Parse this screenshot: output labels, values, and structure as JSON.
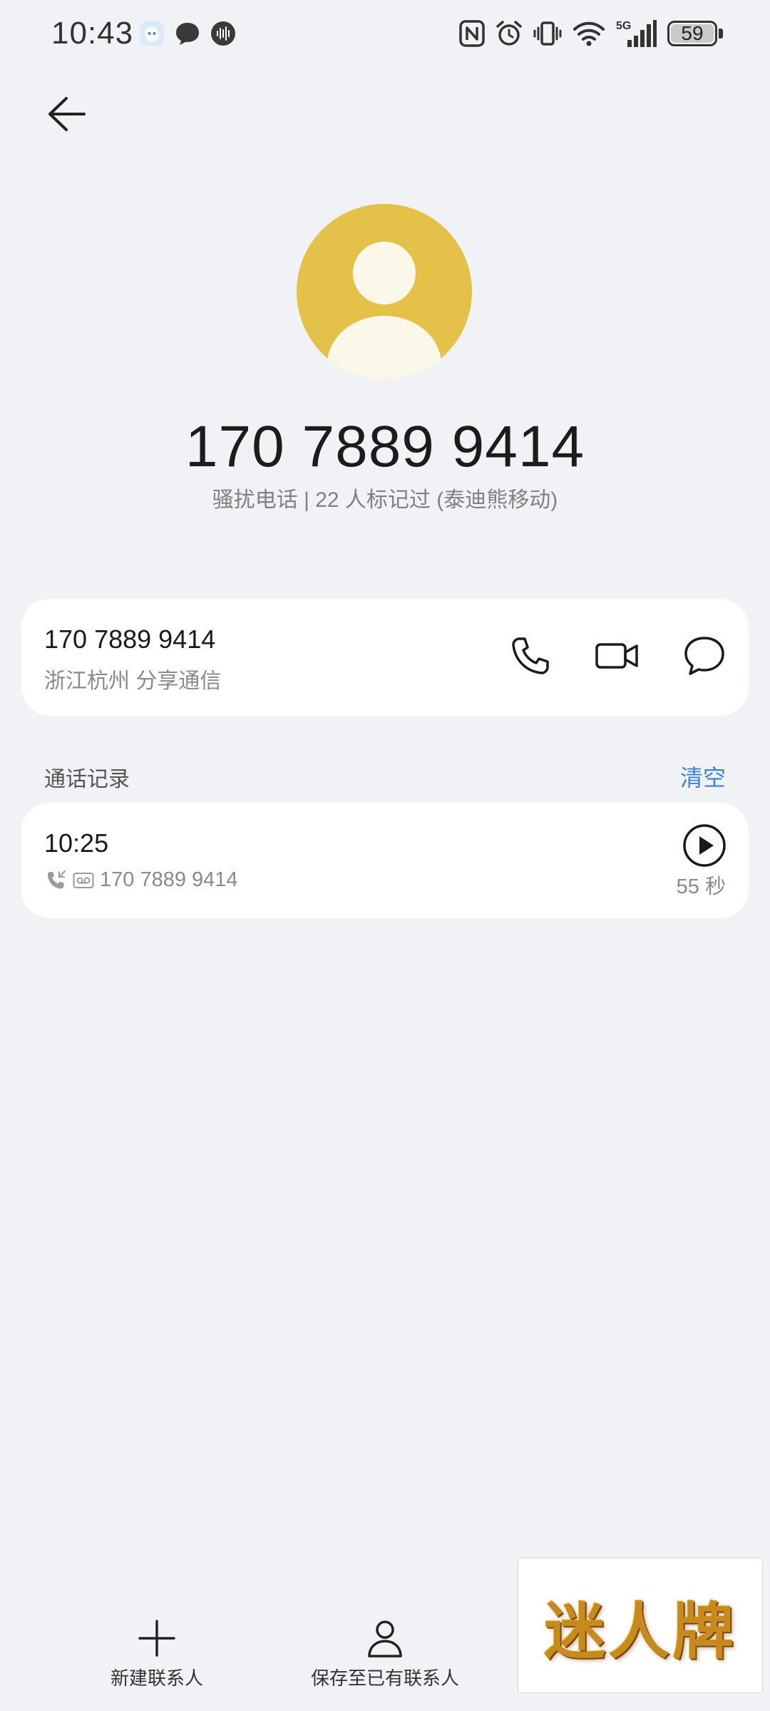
{
  "status_bar": {
    "time": "10:43",
    "notification_icons": [
      "assistant-app-icon",
      "message-bubble-icon",
      "voice-recorder-icon"
    ],
    "system_icons": [
      "nfc-icon",
      "alarm-icon",
      "vibrate-icon",
      "wifi-icon",
      "5g-signal-icon",
      "battery-icon"
    ],
    "network_label": "5G",
    "battery_level": "59"
  },
  "header": {
    "phone_number": "170 7889 9414",
    "tag_line": "骚扰电话 | 22 人标记过 (泰迪熊移动)",
    "avatar_color": "#e4c24a"
  },
  "number_card": {
    "number": "170 7889 9414",
    "location": "浙江杭州 分享通信",
    "actions": [
      "phone-icon",
      "video-call-icon",
      "message-icon"
    ]
  },
  "call_log": {
    "title": "通话记录",
    "clear_label": "清空",
    "entries": [
      {
        "time": "10:25",
        "number": "170 7889 9414",
        "duration": "55 秒"
      }
    ]
  },
  "bottom_bar": {
    "new_contact": "新建联系人",
    "save_existing": "保存至已有联系人"
  },
  "watermark": {
    "text": "迷人牌"
  },
  "colors": {
    "background": "#f1f2f6",
    "card": "#ffffff",
    "accent": "#3d82d8",
    "avatar": "#e4c24a"
  }
}
